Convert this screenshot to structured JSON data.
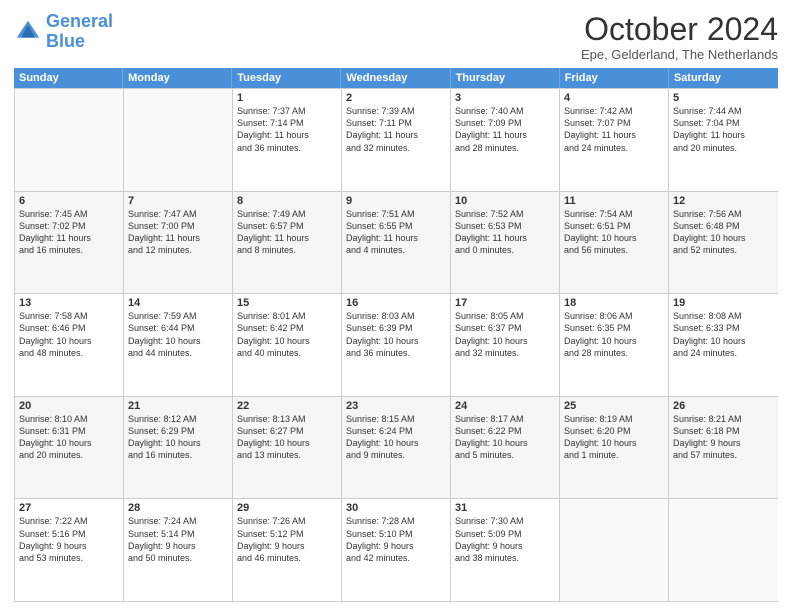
{
  "logo": {
    "line1": "General",
    "line2": "Blue"
  },
  "title": "October 2024",
  "location": "Epe, Gelderland, The Netherlands",
  "weekdays": [
    "Sunday",
    "Monday",
    "Tuesday",
    "Wednesday",
    "Thursday",
    "Friday",
    "Saturday"
  ],
  "rows": [
    [
      {
        "day": "",
        "text": ""
      },
      {
        "day": "",
        "text": ""
      },
      {
        "day": "1",
        "text": "Sunrise: 7:37 AM\nSunset: 7:14 PM\nDaylight: 11 hours\nand 36 minutes."
      },
      {
        "day": "2",
        "text": "Sunrise: 7:39 AM\nSunset: 7:11 PM\nDaylight: 11 hours\nand 32 minutes."
      },
      {
        "day": "3",
        "text": "Sunrise: 7:40 AM\nSunset: 7:09 PM\nDaylight: 11 hours\nand 28 minutes."
      },
      {
        "day": "4",
        "text": "Sunrise: 7:42 AM\nSunset: 7:07 PM\nDaylight: 11 hours\nand 24 minutes."
      },
      {
        "day": "5",
        "text": "Sunrise: 7:44 AM\nSunset: 7:04 PM\nDaylight: 11 hours\nand 20 minutes."
      }
    ],
    [
      {
        "day": "6",
        "text": "Sunrise: 7:45 AM\nSunset: 7:02 PM\nDaylight: 11 hours\nand 16 minutes."
      },
      {
        "day": "7",
        "text": "Sunrise: 7:47 AM\nSunset: 7:00 PM\nDaylight: 11 hours\nand 12 minutes."
      },
      {
        "day": "8",
        "text": "Sunrise: 7:49 AM\nSunset: 6:57 PM\nDaylight: 11 hours\nand 8 minutes."
      },
      {
        "day": "9",
        "text": "Sunrise: 7:51 AM\nSunset: 6:55 PM\nDaylight: 11 hours\nand 4 minutes."
      },
      {
        "day": "10",
        "text": "Sunrise: 7:52 AM\nSunset: 6:53 PM\nDaylight: 11 hours\nand 0 minutes."
      },
      {
        "day": "11",
        "text": "Sunrise: 7:54 AM\nSunset: 6:51 PM\nDaylight: 10 hours\nand 56 minutes."
      },
      {
        "day": "12",
        "text": "Sunrise: 7:56 AM\nSunset: 6:48 PM\nDaylight: 10 hours\nand 52 minutes."
      }
    ],
    [
      {
        "day": "13",
        "text": "Sunrise: 7:58 AM\nSunset: 6:46 PM\nDaylight: 10 hours\nand 48 minutes."
      },
      {
        "day": "14",
        "text": "Sunrise: 7:59 AM\nSunset: 6:44 PM\nDaylight: 10 hours\nand 44 minutes."
      },
      {
        "day": "15",
        "text": "Sunrise: 8:01 AM\nSunset: 6:42 PM\nDaylight: 10 hours\nand 40 minutes."
      },
      {
        "day": "16",
        "text": "Sunrise: 8:03 AM\nSunset: 6:39 PM\nDaylight: 10 hours\nand 36 minutes."
      },
      {
        "day": "17",
        "text": "Sunrise: 8:05 AM\nSunset: 6:37 PM\nDaylight: 10 hours\nand 32 minutes."
      },
      {
        "day": "18",
        "text": "Sunrise: 8:06 AM\nSunset: 6:35 PM\nDaylight: 10 hours\nand 28 minutes."
      },
      {
        "day": "19",
        "text": "Sunrise: 8:08 AM\nSunset: 6:33 PM\nDaylight: 10 hours\nand 24 minutes."
      }
    ],
    [
      {
        "day": "20",
        "text": "Sunrise: 8:10 AM\nSunset: 6:31 PM\nDaylight: 10 hours\nand 20 minutes."
      },
      {
        "day": "21",
        "text": "Sunrise: 8:12 AM\nSunset: 6:29 PM\nDaylight: 10 hours\nand 16 minutes."
      },
      {
        "day": "22",
        "text": "Sunrise: 8:13 AM\nSunset: 6:27 PM\nDaylight: 10 hours\nand 13 minutes."
      },
      {
        "day": "23",
        "text": "Sunrise: 8:15 AM\nSunset: 6:24 PM\nDaylight: 10 hours\nand 9 minutes."
      },
      {
        "day": "24",
        "text": "Sunrise: 8:17 AM\nSunset: 6:22 PM\nDaylight: 10 hours\nand 5 minutes."
      },
      {
        "day": "25",
        "text": "Sunrise: 8:19 AM\nSunset: 6:20 PM\nDaylight: 10 hours\nand 1 minute."
      },
      {
        "day": "26",
        "text": "Sunrise: 8:21 AM\nSunset: 6:18 PM\nDaylight: 9 hours\nand 57 minutes."
      }
    ],
    [
      {
        "day": "27",
        "text": "Sunrise: 7:22 AM\nSunset: 5:16 PM\nDaylight: 9 hours\nand 53 minutes."
      },
      {
        "day": "28",
        "text": "Sunrise: 7:24 AM\nSunset: 5:14 PM\nDaylight: 9 hours\nand 50 minutes."
      },
      {
        "day": "29",
        "text": "Sunrise: 7:26 AM\nSunset: 5:12 PM\nDaylight: 9 hours\nand 46 minutes."
      },
      {
        "day": "30",
        "text": "Sunrise: 7:28 AM\nSunset: 5:10 PM\nDaylight: 9 hours\nand 42 minutes."
      },
      {
        "day": "31",
        "text": "Sunrise: 7:30 AM\nSunset: 5:09 PM\nDaylight: 9 hours\nand 38 minutes."
      },
      {
        "day": "",
        "text": ""
      },
      {
        "day": "",
        "text": ""
      }
    ]
  ]
}
